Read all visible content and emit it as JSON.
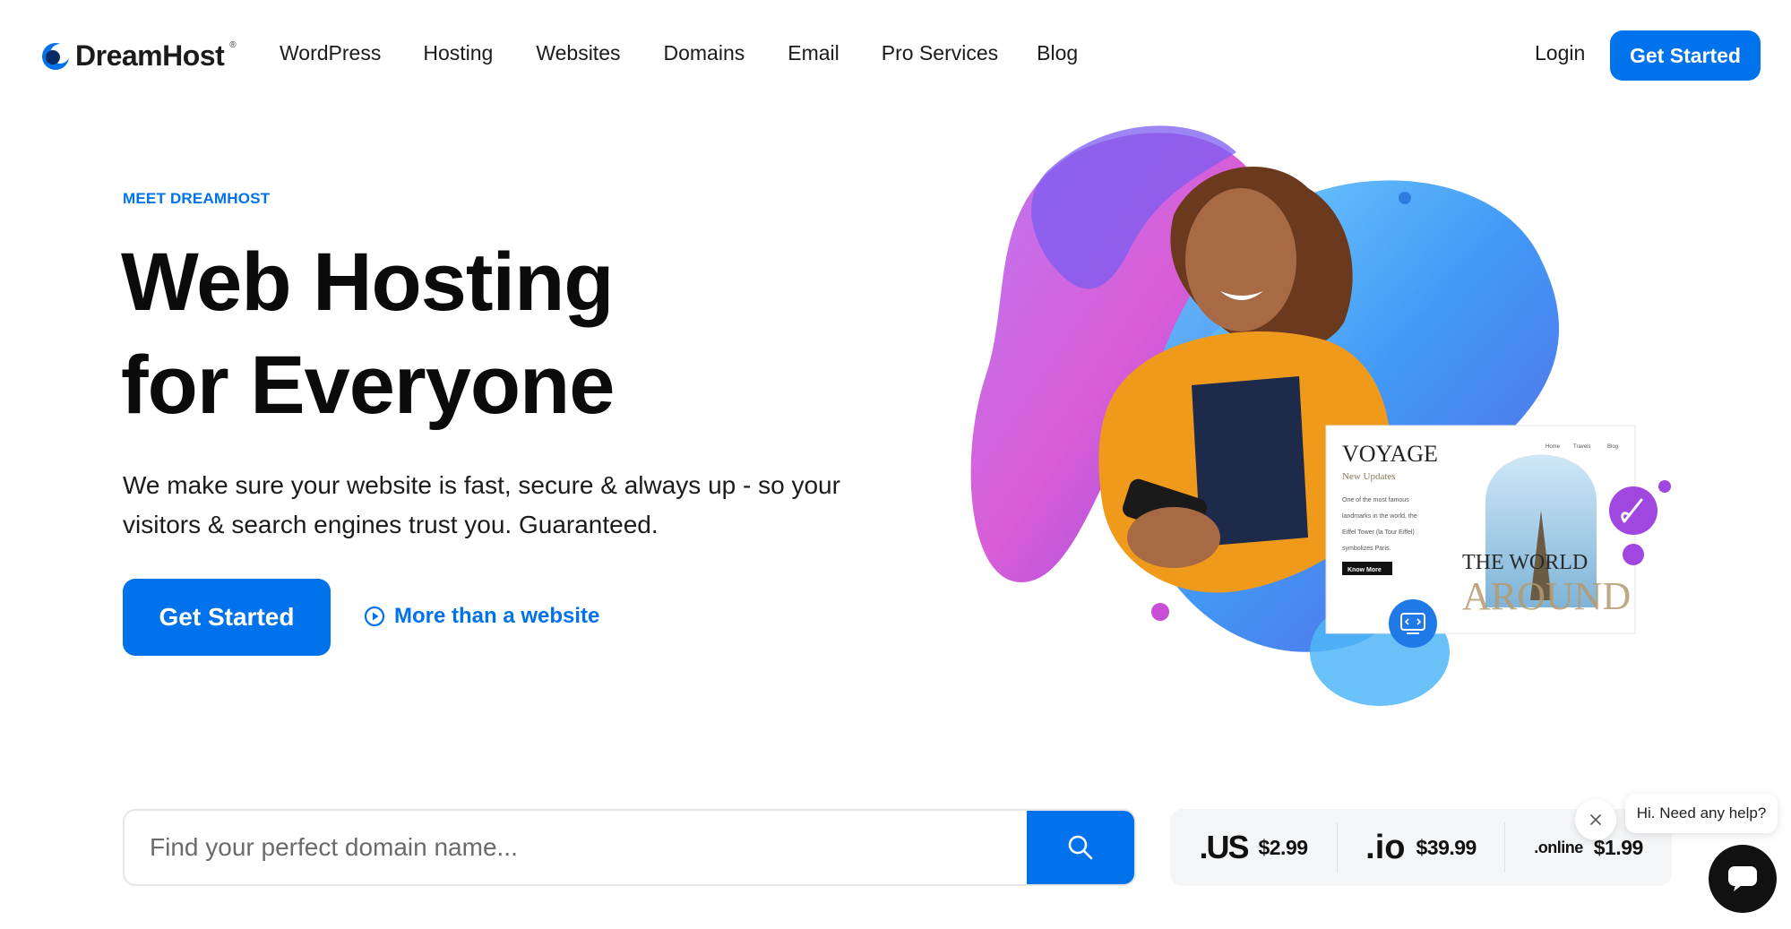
{
  "brand": {
    "name": "DreamHost",
    "tm": "®",
    "accent": "#0073ec"
  },
  "nav": {
    "links": [
      "WordPress",
      "Hosting",
      "Websites",
      "Domains",
      "Email",
      "Pro Services",
      "Blog"
    ],
    "login": "Login",
    "cta": "Get Started"
  },
  "hero": {
    "eyebrow": "MEET DREAMHOST",
    "headline_line1": "Web Hosting",
    "headline_line2": "for Everyone",
    "subcopy": "We make sure your website is fast, secure & always up - so your visitors & search engines trust you. Guaranteed.",
    "cta": "Get Started",
    "video_link": "More than a website"
  },
  "preview_card": {
    "title": "VOYAGE",
    "subtitle": "New Updates",
    "nav": [
      "Home",
      "Travels",
      "Blog"
    ],
    "body_lines": [
      "One of the most famous",
      "landmarks in the world, the",
      "Eiffel Tower (la Tour Eiffel)",
      "symbolizes Paris."
    ],
    "button": "Know More",
    "overlay_line1": "THE WORLD",
    "overlay_line2": "AROUND"
  },
  "domain_search": {
    "placeholder": "Find your perfect domain name...",
    "prices": [
      {
        "tld": ".US",
        "price": "$2.99"
      },
      {
        "tld": ".io",
        "price": "$39.99"
      },
      {
        "tld": ".online",
        "price": "$1.99"
      }
    ]
  },
  "chat": {
    "greeting": "Hi. Need any help?"
  },
  "icons": [
    "logo-mark-icon",
    "play-icon",
    "search-icon",
    "close-icon",
    "chat-icon",
    "paintbrush-icon",
    "code-icon"
  ]
}
